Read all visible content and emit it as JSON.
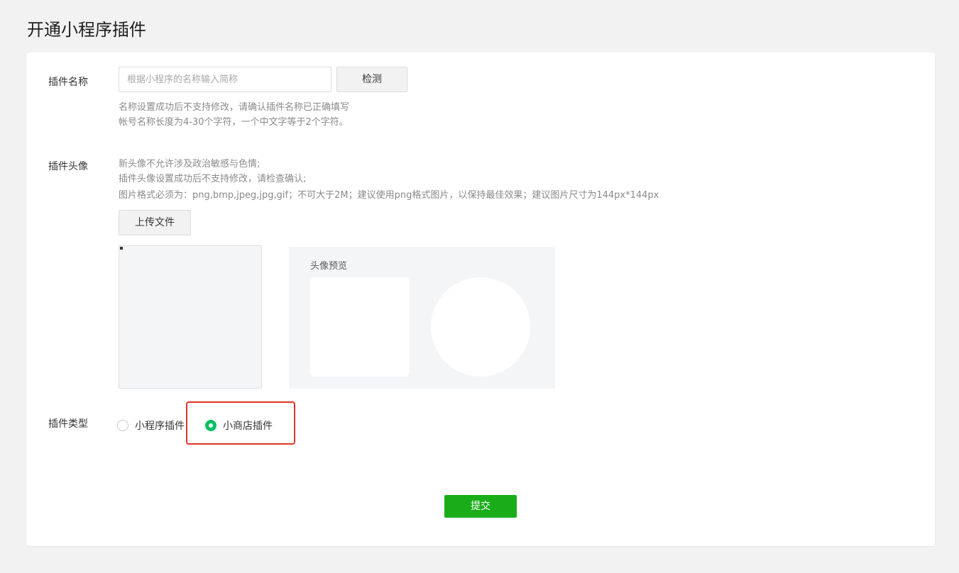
{
  "page": {
    "title": "开通小程序插件"
  },
  "form": {
    "name": {
      "label": "插件名称",
      "placeholder": "根据小程序的名称输入简称",
      "value": "",
      "check_label": "检测",
      "tips": [
        "名称设置成功后不支持修改，请确认插件名称已正确填写",
        "帐号名称长度为4-30个字符，一个中文字等于2个字符。"
      ]
    },
    "avatar": {
      "label": "插件头像",
      "tips": [
        "新头像不允许涉及政治敏感与色情;",
        "插件头像设置成功后不支持修改，请检查确认;",
        "图片格式必须为：png,bmp,jpeg,jpg,gif；不可大于2M；建议使用png格式图片，以保持最佳效果；建议图片尺寸为144px*144px"
      ],
      "upload_label": "上传文件",
      "preview_title": "头像预览"
    },
    "type": {
      "label": "插件类型",
      "options": [
        {
          "label": "小程序插件",
          "checked": false
        },
        {
          "label": "小商店插件",
          "checked": true
        }
      ]
    },
    "submit_label": "提交"
  },
  "colors": {
    "primary": "#1aad19",
    "radio_checked": "#07c160",
    "highlight": "#e03426"
  }
}
